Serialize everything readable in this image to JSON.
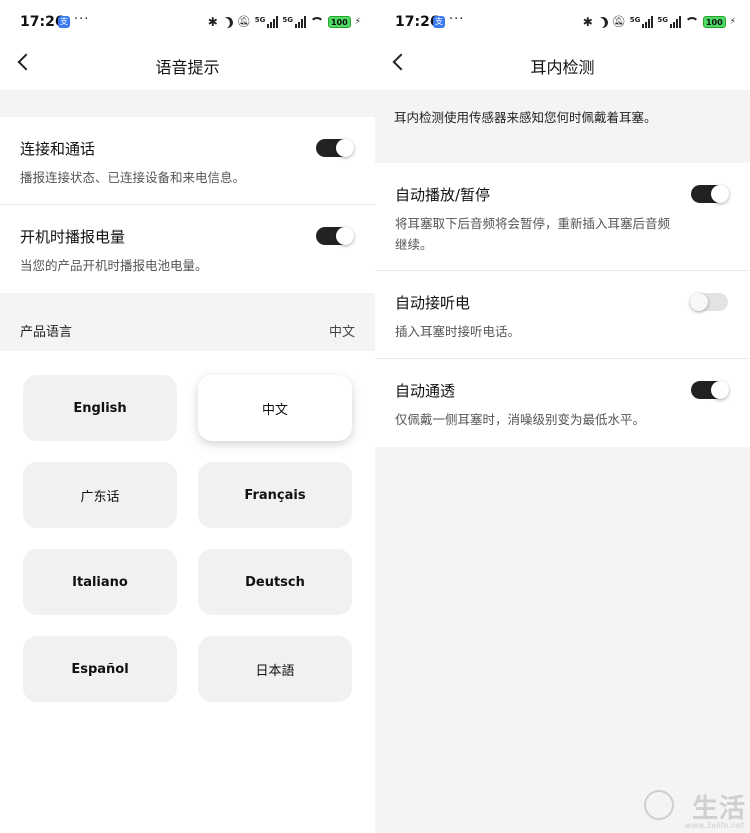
{
  "status_bar": {
    "time": "17:26",
    "app_badge": "支",
    "dots": "···",
    "net_label": "5G",
    "battery": "100",
    "bolt": "⚡"
  },
  "left_screen": {
    "title": "语音提示",
    "settings": [
      {
        "title": "连接和通话",
        "desc": "播报连接状态、已连接设备和来电信息。",
        "enabled": true
      },
      {
        "title": "开机时播报电量",
        "desc": "当您的产品开机时播报电池电量。",
        "enabled": true
      }
    ],
    "language_section": {
      "label": "产品语言",
      "value": "中文"
    },
    "languages": [
      "English",
      "中文",
      "广东话",
      "Français",
      "Italiano",
      "Deutsch",
      "Español",
      "日本語"
    ],
    "selected_language": "中文"
  },
  "right_screen": {
    "title": "耳内检测",
    "intro": "耳内检测使用传感器来感知您何时佩戴着耳塞。",
    "settings": [
      {
        "title": "自动播放/暂停",
        "desc": "将耳塞取下后音频将会暂停，重新插入耳塞后音频继续。",
        "enabled": true
      },
      {
        "title": "自动接听电",
        "desc": "插入耳塞时接听电话。",
        "enabled": false
      },
      {
        "title": "自动通透",
        "desc": "仅佩戴一侧耳塞时，消噪级别变为最低水平。",
        "enabled": true
      }
    ]
  },
  "watermark": {
    "text": "生活",
    "url": "www.3elife.net"
  },
  "colors": {
    "toggle_on": "#222222",
    "toggle_off": "#e3e3e3",
    "background_band": "#f4f4f4",
    "battery": "#4cd964"
  }
}
